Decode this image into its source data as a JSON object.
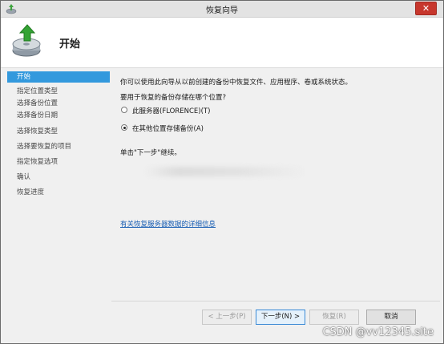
{
  "window": {
    "title": "恢复向导",
    "close_label": "✕"
  },
  "header": {
    "title": "开始"
  },
  "sidebar": {
    "items": [
      {
        "label": "开始",
        "active": true
      },
      {
        "label": "指定位置类型",
        "active": false
      },
      {
        "label": "选择备份位置",
        "active": false
      },
      {
        "label": "选择备份日期",
        "active": false
      },
      {
        "label": "选择恢复类型",
        "active": false
      },
      {
        "label": "选择要恢复的项目",
        "active": false
      },
      {
        "label": "指定恢复选项",
        "active": false
      },
      {
        "label": "确认",
        "active": false
      },
      {
        "label": "恢复进度",
        "active": false
      }
    ]
  },
  "main": {
    "intro": "你可以使用此向导从以前创建的备份中恢复文件、应用程序、卷或系统状态。",
    "question": "要用于恢复的备份存储在哪个位置?",
    "options": [
      {
        "label": "此服务器(FLORENCE)(T)",
        "selected": false
      },
      {
        "label": "在其他位置存储备份(A)",
        "selected": true
      }
    ],
    "hint": "单击\"下一步\"继续。",
    "link": "有关恢复服务器数据的详细信息"
  },
  "footer": {
    "prev": "< 上一步(P)",
    "next": "下一步(N) >",
    "recover": "恢复(R)",
    "cancel": "取消"
  },
  "watermark": "CSDN @vv12345.site"
}
